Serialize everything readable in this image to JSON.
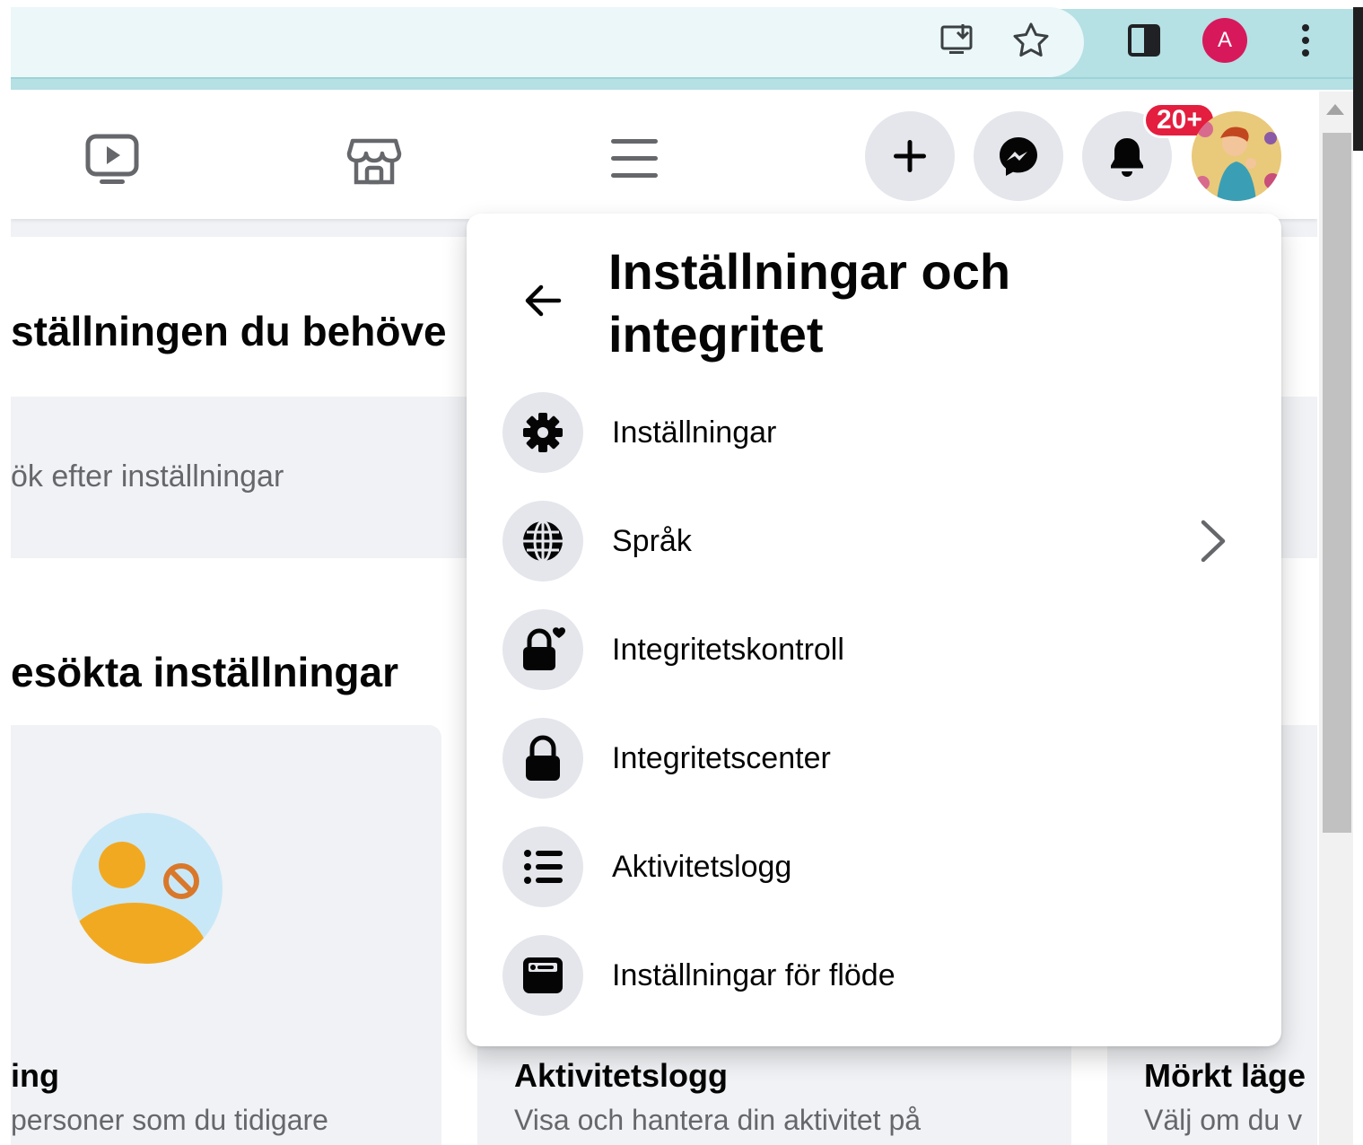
{
  "browser": {
    "install_icon": "install-app-icon",
    "bookmark_icon": "star-icon",
    "sidepanel_icon": "side-panel-icon",
    "profile_initial": "A",
    "menu_icon": "vertical-dots-icon",
    "accent": "#b5e0e4",
    "profile_color": "#d7195c"
  },
  "navbar": {
    "icons": [
      "video-icon",
      "marketplace-icon",
      "menu-icon"
    ],
    "create_icon": "plus-icon",
    "messenger_icon": "messenger-icon",
    "notifications_icon": "bell-icon",
    "notification_badge": "20+",
    "badge_color": "#e41e3f"
  },
  "background_page": {
    "heading_search": "ställningen du behöve",
    "search_placeholder": "ök efter inställningar",
    "heading_visited": "esökta inställningar",
    "tiles": [
      {
        "title": "ing",
        "description": "personer som du tidigare"
      },
      {
        "title": "Aktivitetslogg",
        "description": "Visa och hantera din aktivitet på"
      },
      {
        "title": "Mörkt läge",
        "description": "Välj om du v"
      }
    ]
  },
  "menu": {
    "title": "Inställningar och integritet",
    "back_icon": "arrow-left-icon",
    "items": [
      {
        "label": "Inställningar",
        "icon": "gear-icon"
      },
      {
        "label": "Språk",
        "icon": "globe-icon",
        "has_submenu": true
      },
      {
        "label": "Integritetskontroll",
        "icon": "lock-heart-icon"
      },
      {
        "label": "Integritetscenter",
        "icon": "lock-icon"
      },
      {
        "label": "Aktivitetslogg",
        "icon": "list-icon"
      },
      {
        "label": "Inställningar för flöde",
        "icon": "feed-icon"
      }
    ]
  }
}
